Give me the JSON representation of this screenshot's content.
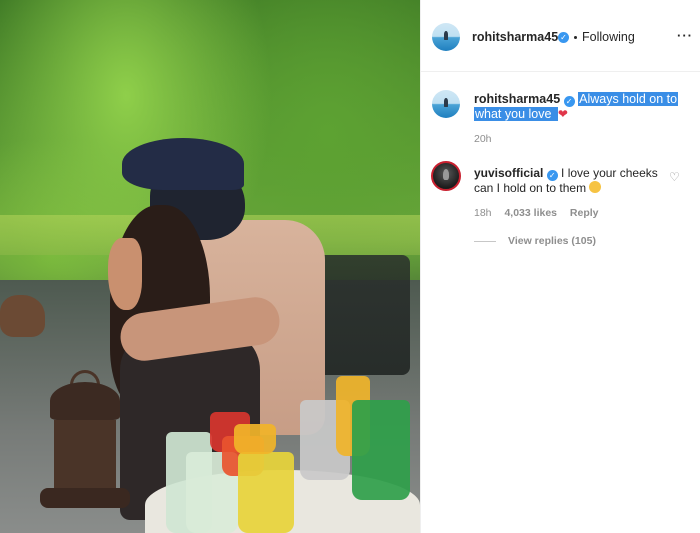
{
  "post": {
    "author": "rohitsharma45",
    "follow_status": "Following",
    "more_icon": "more-horizontal-icon"
  },
  "caption": {
    "author": "rohitsharma45",
    "line1": "Always hold on to",
    "line2": "what you love",
    "heart": "❤",
    "time": "20h"
  },
  "comment": {
    "author": "yuvisofficial",
    "line1": "I love your cheeks",
    "line2": "can I hold on to them",
    "time": "18h",
    "likes": "4,033 likes",
    "reply_label": "Reply",
    "view_replies": "View replies (105)"
  },
  "colors": {
    "verified_badge": "#3897f0",
    "highlight": "#3a8ee6",
    "heart": "#e0364a"
  }
}
